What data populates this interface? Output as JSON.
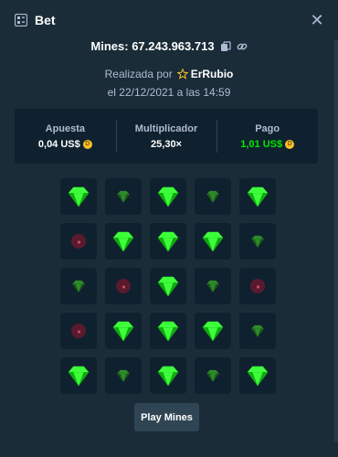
{
  "header": {
    "title": "Bet",
    "icon": "bet-slip-icon",
    "close_icon": "close-icon"
  },
  "bet": {
    "mines_id": "Mines: 67.243.963.713",
    "placed_by_prefix": "Realizada por",
    "username": "ErRubio",
    "date": "el 22/12/2021 a las 14:59"
  },
  "stats": {
    "wager_label": "Apuesta",
    "wager_value": "0,04 US$",
    "multiplier_label": "Multiplicador",
    "multiplier_value": "25,30×",
    "payout_label": "Pago",
    "payout_value": "1,01 US$",
    "payout_color": "#00e701"
  },
  "board": [
    [
      "gem",
      "gem-dim",
      "gem",
      "gem-dim",
      "gem"
    ],
    [
      "mine",
      "gem",
      "gem",
      "gem",
      "gem-dim"
    ],
    [
      "gem-dim",
      "mine",
      "gem",
      "gem-dim",
      "mine"
    ],
    [
      "mine",
      "gem",
      "gem",
      "gem",
      "gem-dim"
    ],
    [
      "gem",
      "gem-dim",
      "gem",
      "gem-dim",
      "gem"
    ]
  ],
  "actions": {
    "play_label": "Play Mines"
  }
}
